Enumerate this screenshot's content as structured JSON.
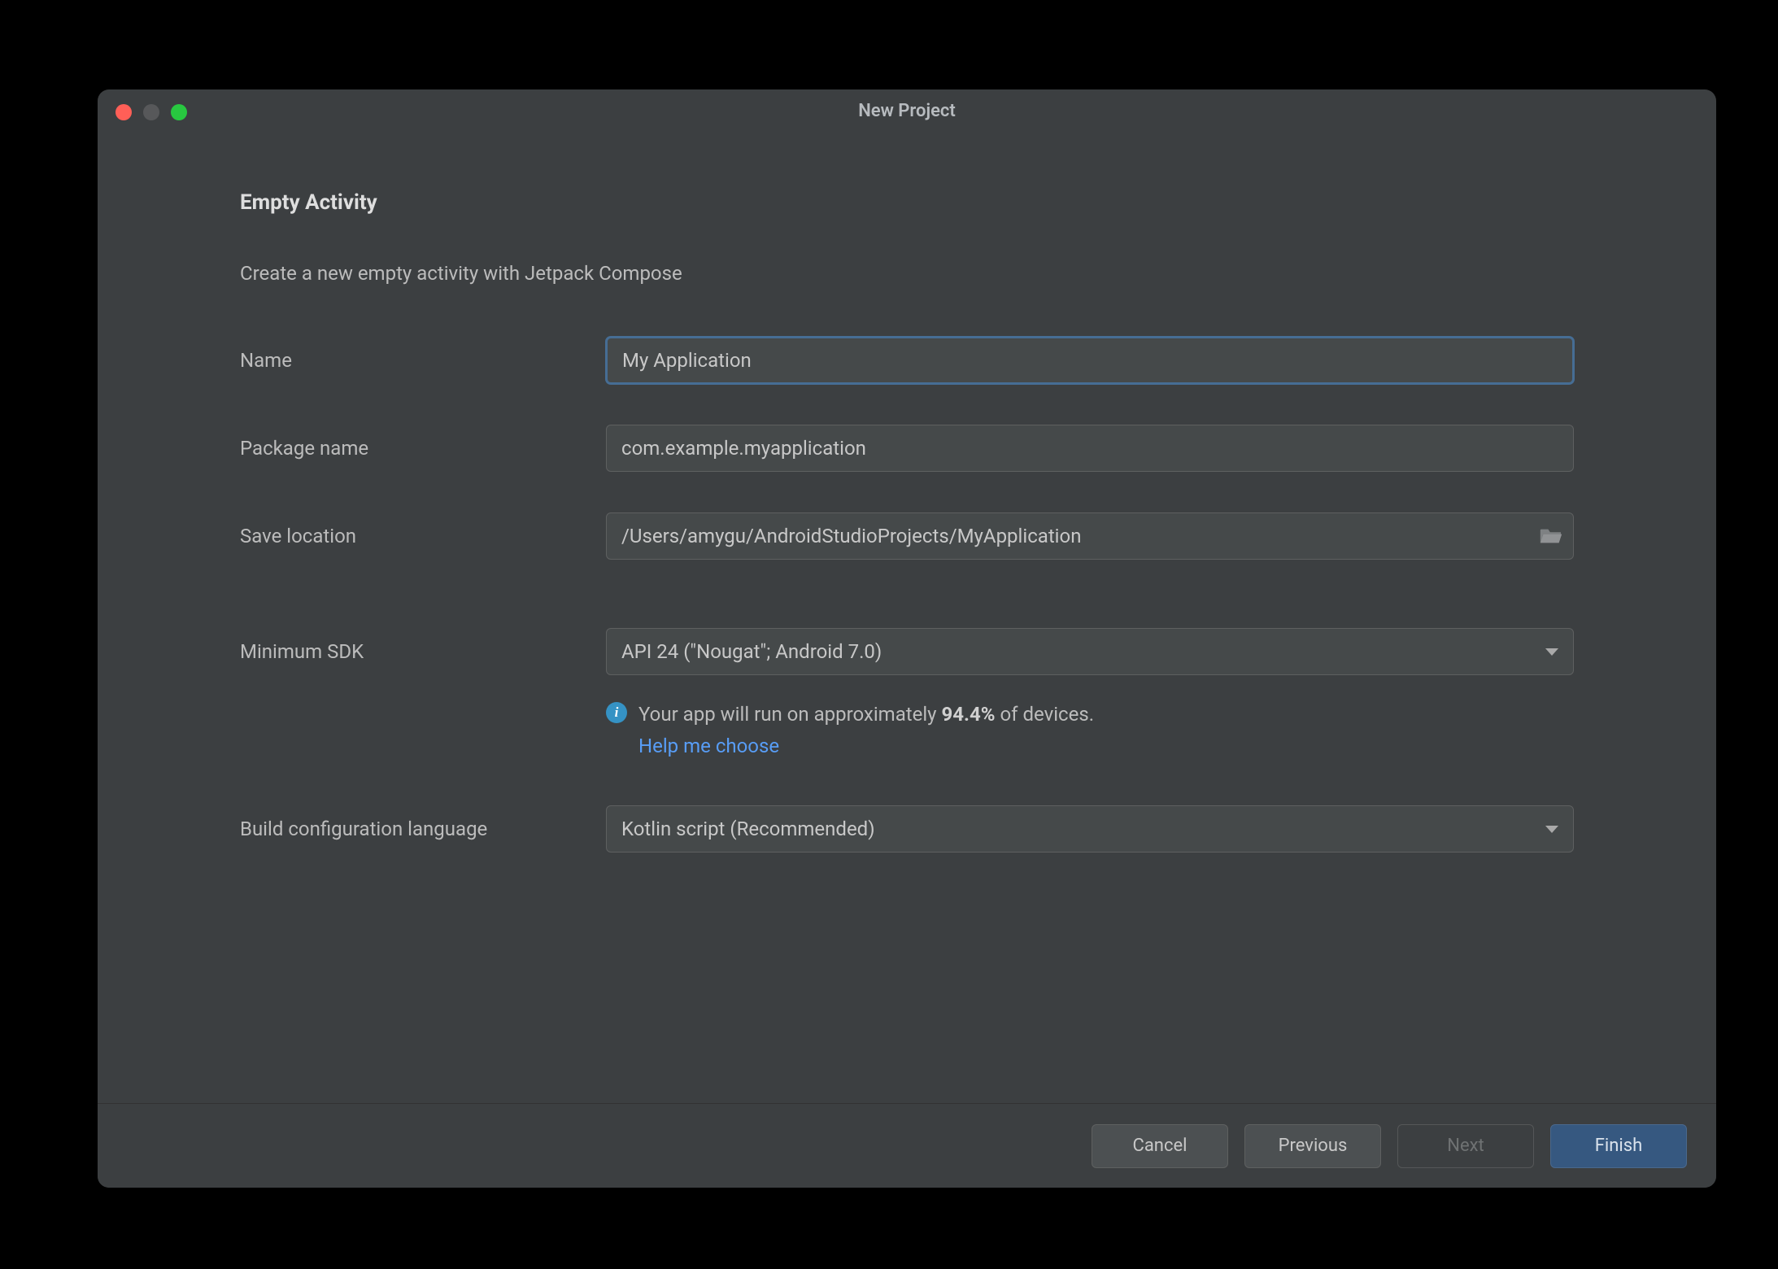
{
  "window": {
    "title": "New Project"
  },
  "page": {
    "heading": "Empty Activity",
    "subheading": "Create a new empty activity with Jetpack Compose"
  },
  "form": {
    "name_label": "Name",
    "name_value": "My Application",
    "package_label": "Package name",
    "package_value": "com.example.myapplication",
    "location_label": "Save location",
    "location_value": "/Users/amygu/AndroidStudioProjects/MyApplication",
    "sdk_label": "Minimum SDK",
    "sdk_value": "API 24 (\"Nougat\"; Android 7.0)",
    "sdk_info_prefix": "Your app will run on approximately ",
    "sdk_info_percent": "94.4%",
    "sdk_info_suffix": " of devices.",
    "sdk_help_link": "Help me choose",
    "build_lang_label": "Build configuration language",
    "build_lang_value": "Kotlin script (Recommended)"
  },
  "buttons": {
    "cancel": "Cancel",
    "previous": "Previous",
    "next": "Next",
    "finish": "Finish"
  }
}
